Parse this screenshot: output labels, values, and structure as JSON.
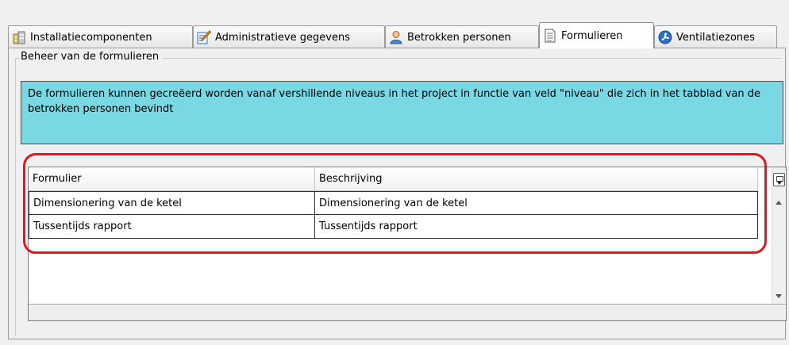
{
  "tabs": [
    {
      "label": "Installatiecomponenten",
      "icon": "building-icon",
      "active": false
    },
    {
      "label": "Administratieve gegevens",
      "icon": "form-pencil-icon",
      "active": false
    },
    {
      "label": "Betrokken personen",
      "icon": "person-icon",
      "active": false
    },
    {
      "label": "Formulieren",
      "icon": "document-icon",
      "active": true
    },
    {
      "label": "Ventilatiezones",
      "icon": "fan-icon",
      "active": false
    }
  ],
  "group": {
    "title": "Beheer van de formulieren",
    "info": "De formulieren kunnen gecreëerd worden vanaf vershillende niveaus in het project in functie van veld \"niveau\" die zich in het tabblad van de betrokken personen bevindt"
  },
  "grid": {
    "columns": [
      "Formulier",
      "Beschrijving"
    ],
    "rows": [
      [
        "Dimensionering van de ketel",
        "Dimensionering van de ketel"
      ],
      [
        "Tussentijds rapport",
        "Tussentijds rapport"
      ]
    ]
  },
  "colors": {
    "info_bg": "#79d8e4",
    "highlight": "#e2161e"
  }
}
